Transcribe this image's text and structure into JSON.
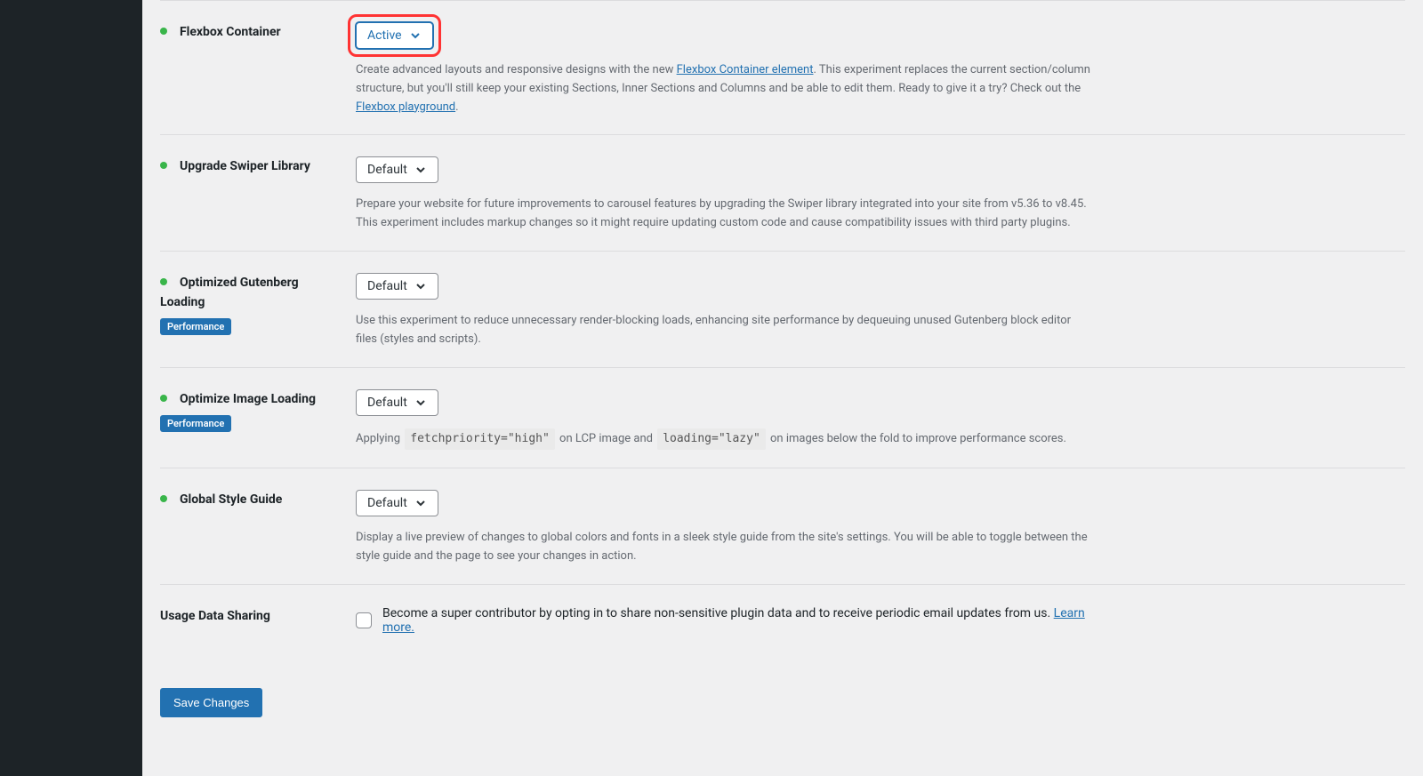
{
  "settings": [
    {
      "title": "Flexbox Container",
      "indicator": true,
      "select_value": "Active",
      "highlighted": true,
      "badge": null,
      "description_pre": "Create advanced layouts and responsive designs with the new ",
      "link1_text": "Flexbox Container element",
      "description_mid": ". This experiment replaces the current section/column structure, but you'll still keep your existing Sections, Inner Sections and Columns and be able to edit them. Ready to give it a try? Check out the ",
      "link2_text": "Flexbox playground",
      "description_post": "."
    },
    {
      "title": "Upgrade Swiper Library",
      "indicator": true,
      "select_value": "Default",
      "highlighted": false,
      "badge": null,
      "description": "Prepare your website for future improvements to carousel features by upgrading the Swiper library integrated into your site from v5.36 to v8.45. This experiment includes markup changes so it might require updating custom code and cause compatibility issues with third party plugins."
    },
    {
      "title": "Optimized Gutenberg Loading",
      "indicator": true,
      "select_value": "Default",
      "highlighted": false,
      "badge": "Performance",
      "description": "Use this experiment to reduce unnecessary render-blocking loads, enhancing site performance by dequeuing unused Gutenberg block editor files (styles and scripts)."
    },
    {
      "title": "Optimize Image Loading",
      "indicator": true,
      "select_value": "Default",
      "highlighted": false,
      "badge": "Performance",
      "description_pre": "Applying ",
      "code1": "fetchpriority=\"high\"",
      "description_mid": " on LCP image and ",
      "code2": "loading=\"lazy\"",
      "description_post": " on images below the fold to improve performance scores."
    },
    {
      "title": "Global Style Guide",
      "indicator": true,
      "select_value": "Default",
      "highlighted": false,
      "badge": null,
      "description": "Display a live preview of changes to global colors and fonts in a sleek style guide from the site's settings. You will be able to toggle between the style guide and the page to see your changes in action."
    }
  ],
  "usage_data": {
    "title": "Usage Data Sharing",
    "checkbox_text": "Become a super contributor by opting in to share non-sensitive plugin data and to receive periodic email updates from us. ",
    "learn_more": "Learn more."
  },
  "save_button": "Save Changes"
}
